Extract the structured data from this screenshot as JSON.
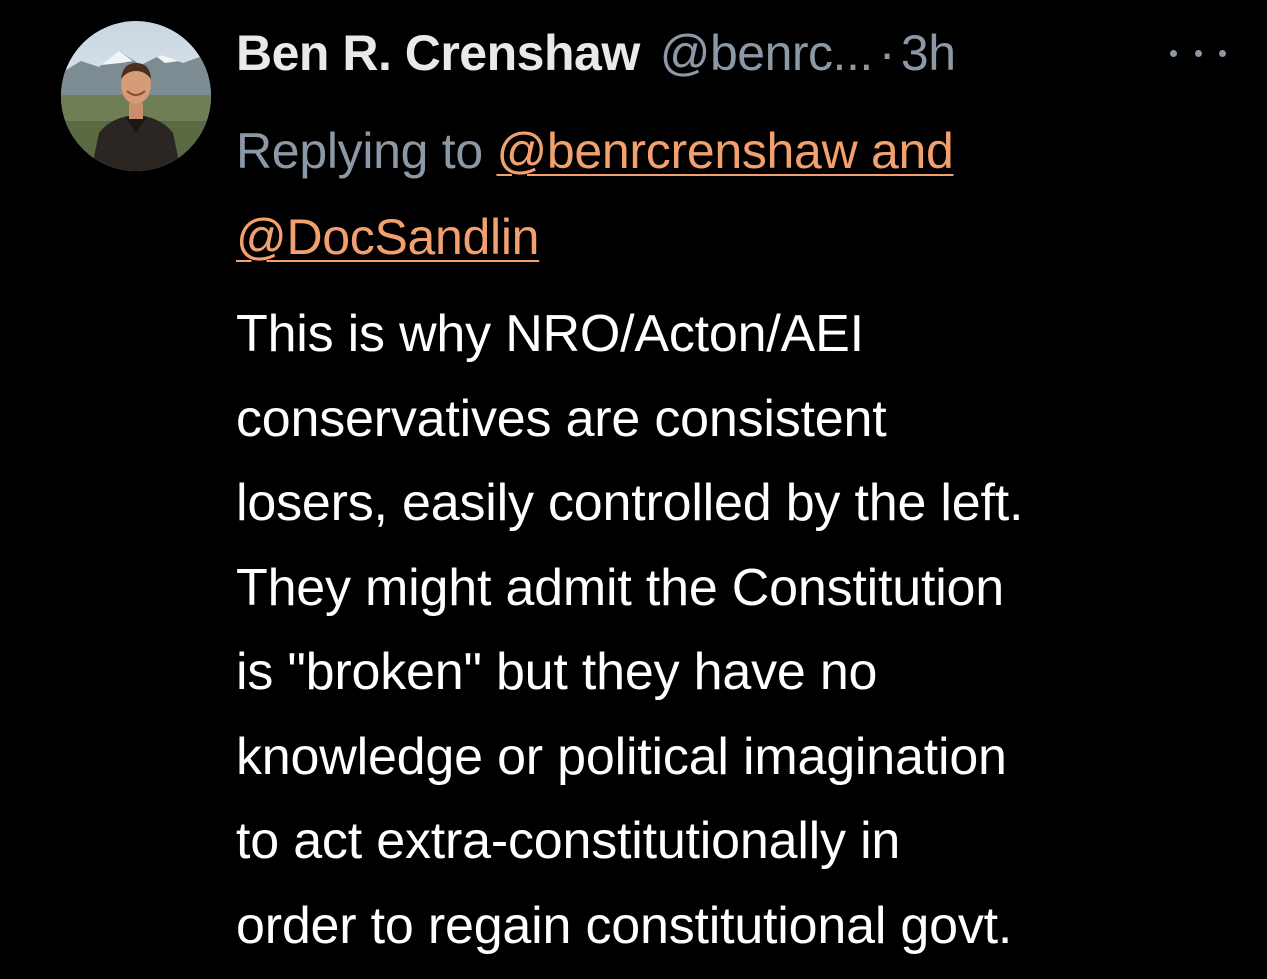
{
  "tweet": {
    "display_name": "Ben R. Crenshaw",
    "handle": "@benrc...",
    "separator": "·",
    "timestamp": "3h",
    "more_icon": "more-horizontal-icon",
    "reply": {
      "prefix": "Replying to ",
      "mention_line1": "@benrcrenshaw and",
      "mention_line2": "@DocSandlin"
    },
    "body_lines": [
      "This is why NRO/Acton/AEI",
      "conservatives are consistent",
      "losers, easily controlled by the left.",
      "They might admit the Constitution",
      "is \"broken\" but they have no",
      "knowledge or political imagination",
      "to act extra-constitutionally in",
      "order to regain constitutional govt."
    ]
  },
  "colors": {
    "background": "#000000",
    "text_primary": "#ffffff",
    "text_secondary": "#8b98a5",
    "mention": "#f2a16e"
  }
}
